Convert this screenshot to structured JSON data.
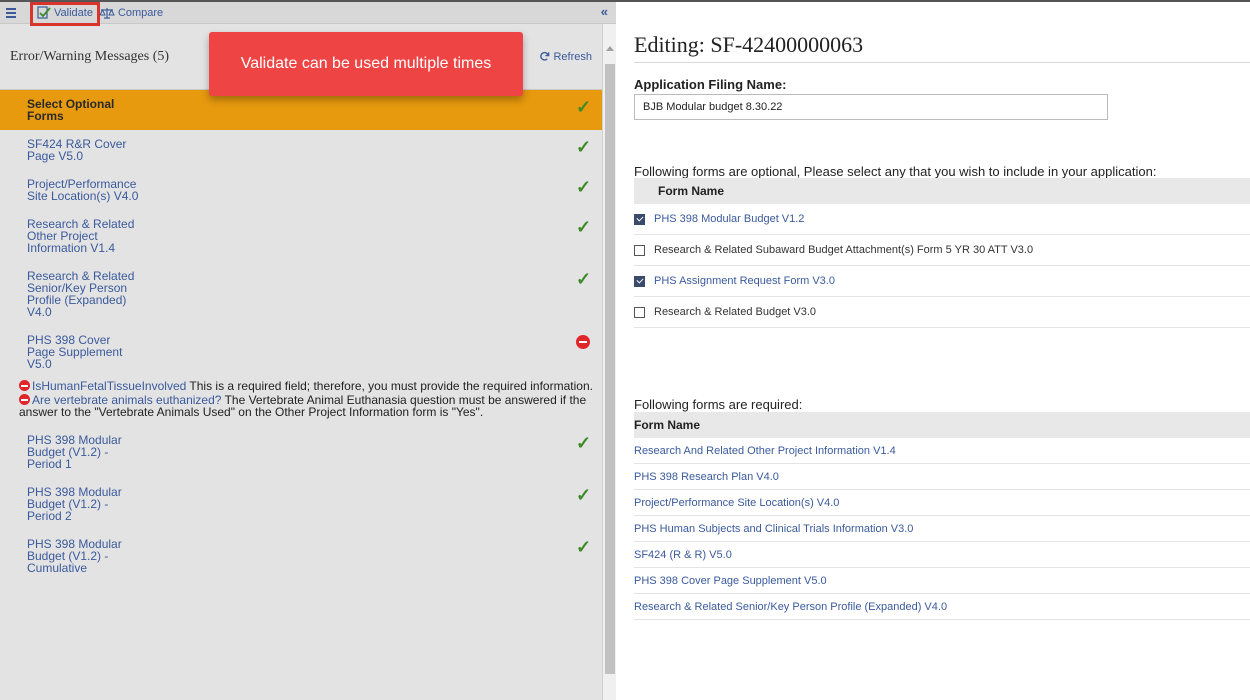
{
  "toolbar": {
    "validate_label": "Validate",
    "compare_label": "Compare"
  },
  "callout_text": "Validate can be used multiple times",
  "messages_header": "Error/Warning Messages (5)",
  "refresh_label": "Refresh",
  "form_list": [
    {
      "lines": [
        "Select Optional",
        "Forms"
      ],
      "status": "ok",
      "selected": true
    },
    {
      "lines": [
        "SF424 R&R Cover",
        "Page V5.0"
      ],
      "status": "ok",
      "selected": false
    },
    {
      "lines": [
        "Project/Performance",
        "Site Location(s) V4.0"
      ],
      "status": "ok",
      "selected": false
    },
    {
      "lines": [
        "Research & Related",
        "Other Project",
        "Information V1.4"
      ],
      "status": "ok",
      "selected": false
    },
    {
      "lines": [
        "Research & Related",
        "Senior/Key Person",
        "Profile (Expanded)",
        "V4.0"
      ],
      "status": "ok",
      "selected": false
    },
    {
      "lines": [
        "PHS 398 Cover",
        "Page Supplement",
        "V5.0"
      ],
      "status": "error",
      "selected": false
    },
    {
      "lines": [
        "PHS 398 Modular",
        "Budget (V1.2) -",
        "Period 1"
      ],
      "status": "ok",
      "selected": false
    },
    {
      "lines": [
        "PHS 398 Modular",
        "Budget (V1.2) -",
        "Period 2"
      ],
      "status": "ok",
      "selected": false
    },
    {
      "lines": [
        "PHS 398 Modular",
        "Budget (V1.2) -",
        "Cumulative"
      ],
      "status": "ok",
      "selected": false
    }
  ],
  "errors": [
    {
      "field": "IsHumanFetalTissueInvolved",
      "text": "This is a required field; therefore, you must provide the required information."
    },
    {
      "field": "Are vertebrate animals euthanized?",
      "text": "The Vertebrate Animal Euthanasia question must be answered if the answer to the \"Vertebrate Animals Used\" on the Other Project Information form is \"Yes\"."
    }
  ],
  "editing_title": "Editing: SF-42400000063",
  "app_filing_label": "Application Filing Name:",
  "app_filing_value": "BJB Modular budget 8.30.22",
  "optional_intro": "Following forms are optional, Please select any that you wish to include in your application:",
  "optional_header": "Form Name",
  "optional_forms": [
    {
      "label": "PHS 398 Modular Budget V1.2",
      "checked": true
    },
    {
      "label": "Research & Related Subaward Budget Attachment(s) Form 5 YR 30 ATT V3.0",
      "checked": false
    },
    {
      "label": "PHS Assignment Request Form V3.0",
      "checked": true
    },
    {
      "label": "Research & Related Budget V3.0",
      "checked": false
    }
  ],
  "required_intro": "Following forms are required:",
  "required_header": "Form Name",
  "required_forms": [
    "Research And Related Other Project Information V1.4",
    "PHS 398 Research Plan V4.0",
    "Project/Performance Site Location(s) V4.0",
    "PHS Human Subjects and Clinical Trials Information V3.0",
    "SF424 (R & R) V5.0",
    "PHS 398 Cover Page Supplement V5.0",
    "Research & Related Senior/Key Person Profile (Expanded) V4.0"
  ],
  "colors": {
    "selected_bg": "#e89a0e",
    "link": "#3a5a9c",
    "ok": "#3d8b27",
    "error": "#e0262a",
    "callout": "#ef4444"
  }
}
